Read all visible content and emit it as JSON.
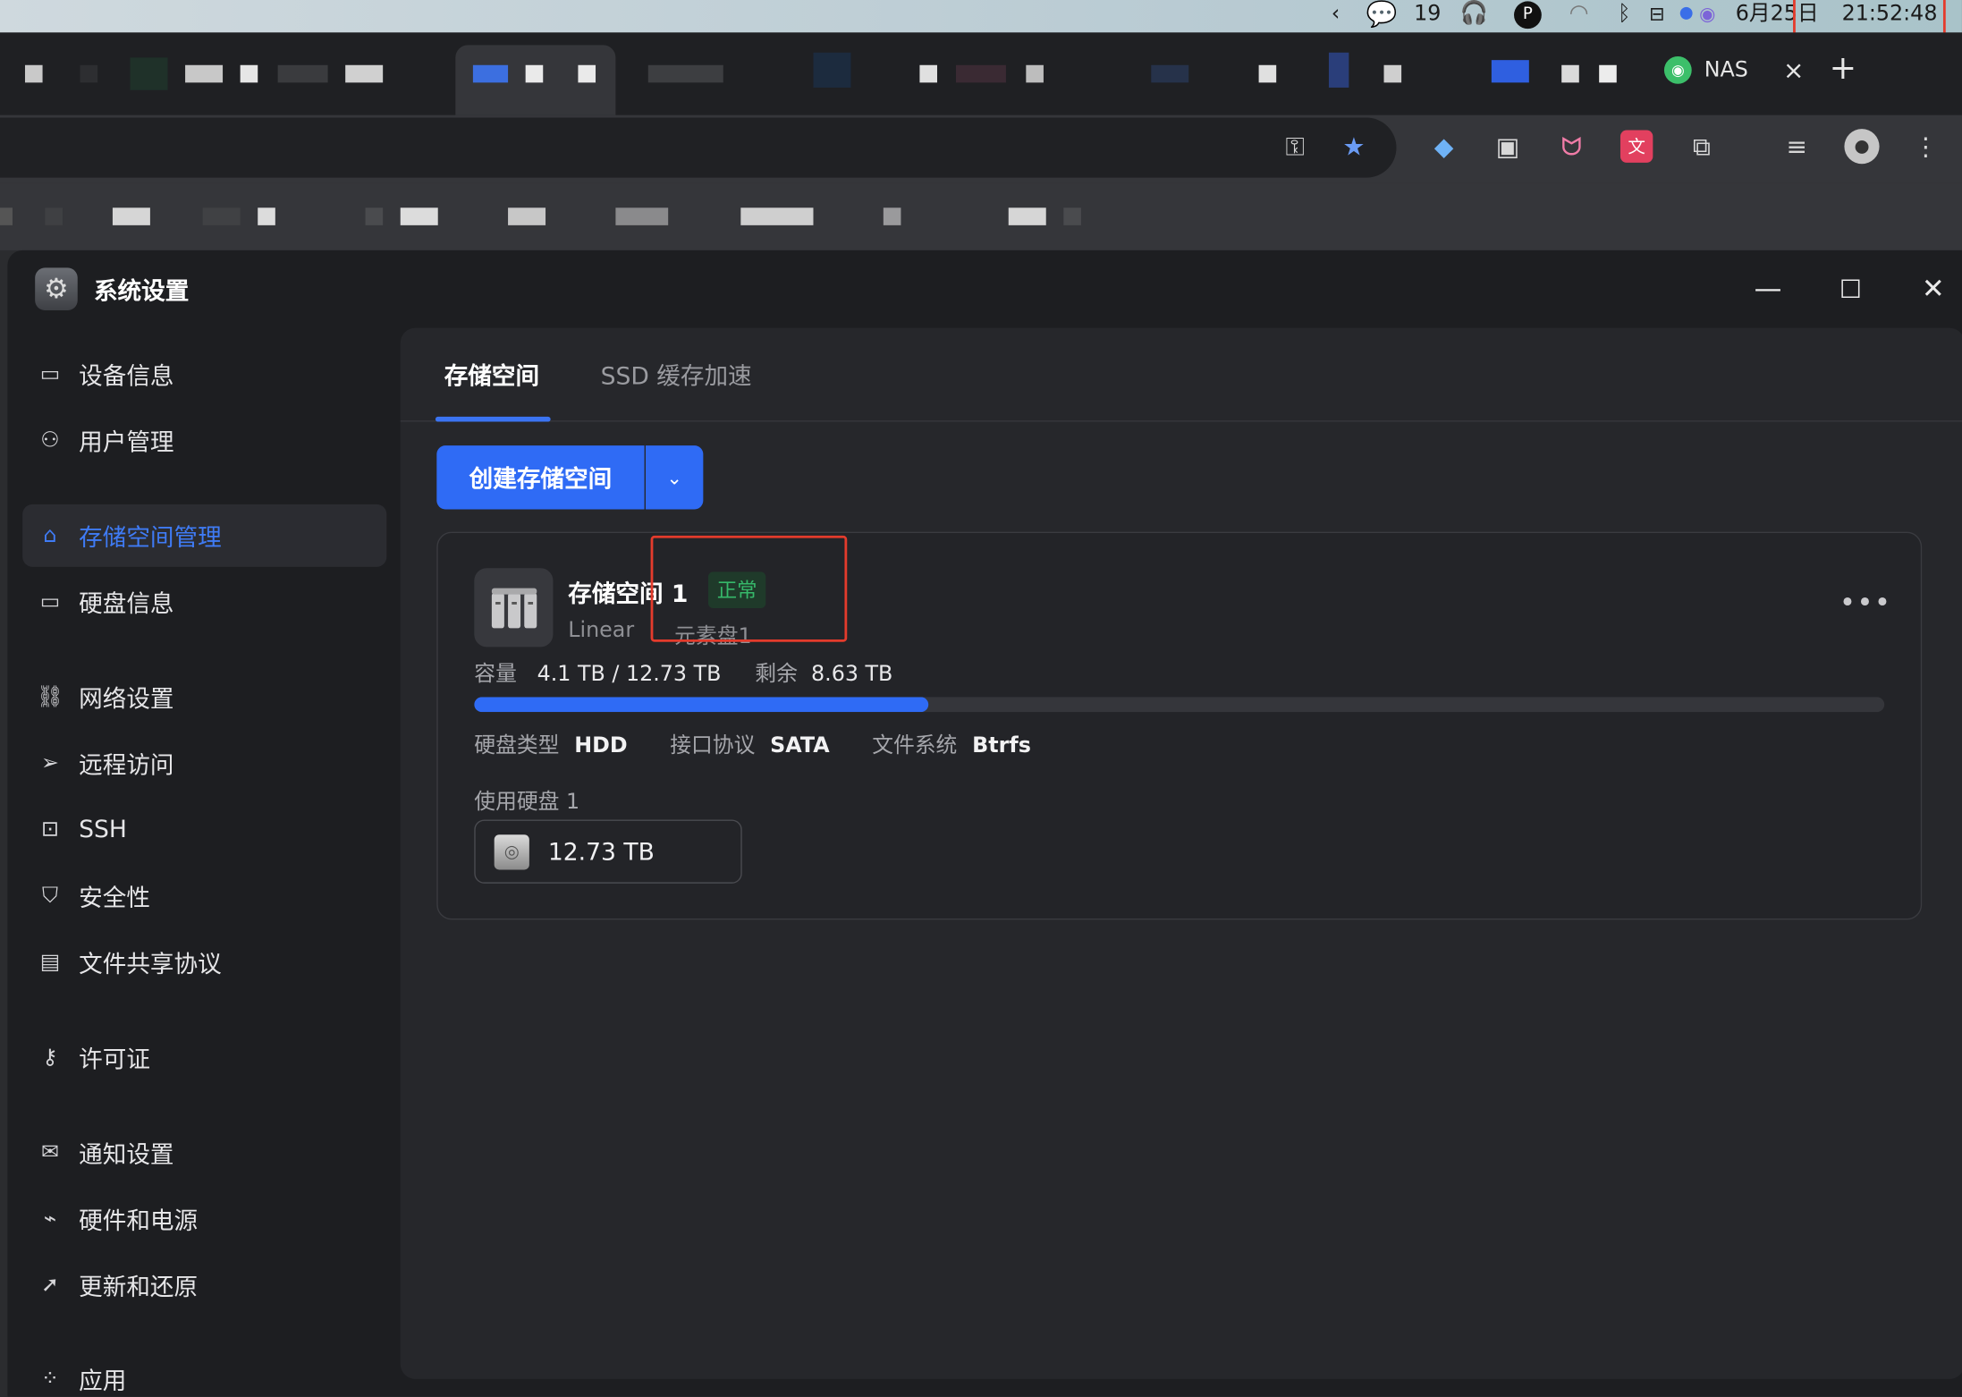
{
  "menubar": {
    "chat_count": "19",
    "date": "6月25日",
    "time": "21:52:48"
  },
  "browser": {
    "active_tab_label": "NAS",
    "tab_close": "×",
    "new_tab": "+"
  },
  "app": {
    "title": "系统设置",
    "sidebar": [
      {
        "label": "设备信息",
        "icon": "device-icon"
      },
      {
        "label": "用户管理",
        "icon": "user-gear-icon"
      },
      {
        "label": "存储空间管理",
        "icon": "storage-icon",
        "active": true
      },
      {
        "label": "硬盘信息",
        "icon": "disk-icon"
      },
      {
        "label": "网络设置",
        "icon": "network-icon"
      },
      {
        "label": "远程访问",
        "icon": "send-icon"
      },
      {
        "label": "SSH",
        "icon": "terminal-icon"
      },
      {
        "label": "安全性",
        "icon": "shield-icon"
      },
      {
        "label": "文件共享协议",
        "icon": "document-icon"
      },
      {
        "label": "许可证",
        "icon": "key-icon"
      },
      {
        "label": "通知设置",
        "icon": "mail-icon"
      },
      {
        "label": "硬件和电源",
        "icon": "power-icon"
      },
      {
        "label": "更新和还原",
        "icon": "rocket-icon"
      },
      {
        "label": "应用",
        "icon": "apps-icon"
      }
    ],
    "tabs": [
      {
        "label": "存储空间",
        "active": true
      },
      {
        "label": "SSD 缓存加速",
        "active": false
      }
    ],
    "create_button": "创建存储空间",
    "volume": {
      "name": "存储空间 1",
      "status": "正常",
      "mode": "Linear",
      "label": "元素盘1",
      "capacity_label": "容量",
      "used": "4.1 TB",
      "separator": "/",
      "total": "12.73 TB",
      "remaining_label": "剩余",
      "remaining": "8.63 TB",
      "usage_fraction": 0.322,
      "disk_type_label": "硬盘类型",
      "disk_type": "HDD",
      "interface_label": "接口协议",
      "interface": "SATA",
      "fs_label": "文件系统",
      "fs": "Btrfs",
      "disks_used_label": "使用硬盘 1",
      "disk_size": "12.73 TB"
    }
  },
  "colors": {
    "accent": "#2f6bf5",
    "status_green": "#36b86a",
    "highlight_box": "#e43b2c"
  }
}
